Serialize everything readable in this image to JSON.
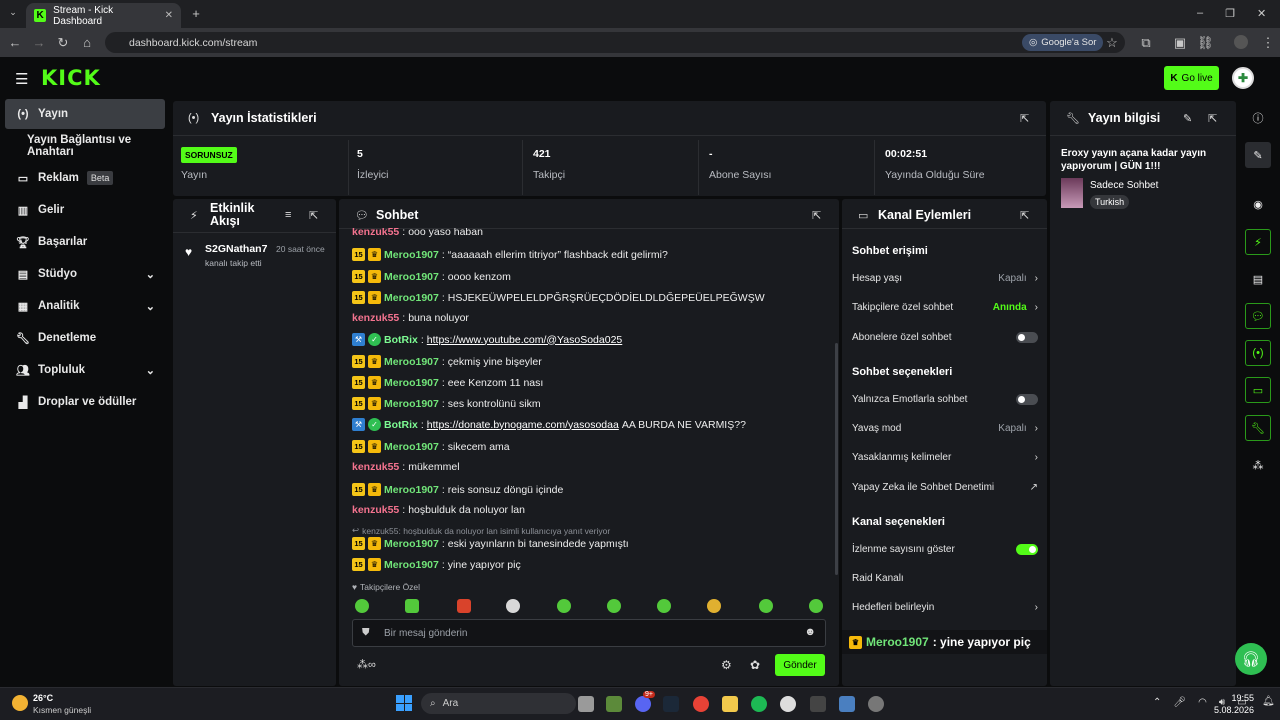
{
  "browser": {
    "tab_title": "Stream - Kick Dashboard",
    "url": "dashboard.kick.com/stream",
    "google_btn": "Google'a Sor"
  },
  "header": {
    "logo": "KICK",
    "go_live": "Go live"
  },
  "sidebar": {
    "items": [
      {
        "label": "Yayın",
        "icon": "broadcast-icon"
      },
      {
        "label": "Yayın Bağlantısı ve Anahtarı"
      },
      {
        "label": "Reklam",
        "badge": "Beta",
        "icon": "ad-icon"
      },
      {
        "label": "Gelir",
        "icon": "chart-icon"
      },
      {
        "label": "Başarılar",
        "icon": "trophy-icon"
      },
      {
        "label": "Stüdyo",
        "icon": "studio-icon"
      },
      {
        "label": "Analitik",
        "icon": "analytics-icon"
      },
      {
        "label": "Denetleme",
        "icon": "wrench-icon"
      },
      {
        "label": "Topluluk",
        "icon": "community-icon"
      },
      {
        "label": "Droplar ve ödüller",
        "icon": "drops-icon"
      }
    ]
  },
  "stats": {
    "title": "Yayın İstatistikleri",
    "badge": "SORUNSUZ",
    "items": [
      {
        "value": "",
        "label": "Yayın"
      },
      {
        "value": "5",
        "label": "İzleyici"
      },
      {
        "value": "421",
        "label": "Takipçi"
      },
      {
        "value": "-",
        "label": "Abone Sayısı"
      },
      {
        "value": "00:02:51",
        "label": "Yayında Olduğu Süre"
      }
    ]
  },
  "activity": {
    "title_l1": "Etkinlik",
    "title_l2": "Akışı",
    "user": "S2GNathan7",
    "time": "20 saat önce",
    "text": "kanalı takip etti"
  },
  "chat": {
    "title": "Sohbet",
    "top_partial": {
      "user": "kenzuk55",
      "text": "ooo yaso haban"
    },
    "messages": [
      {
        "user": "Meroo1907",
        "text": "“aaaaaah ellerim titriyor” flashback edit gelirmi?"
      },
      {
        "user": "Meroo1907",
        "text": "oooo kenzom"
      },
      {
        "user": "Meroo1907",
        "text": "HSJEKEÜWPELELDPĞRŞRÜEÇDÖDİELDLDĞEPEÜELPEĞWŞW"
      },
      {
        "user": "kenzuk55",
        "text": "buna noluyor"
      },
      {
        "user": "BotRix",
        "link": "https://www.youtube.com/@YasoSoda025",
        "text": ""
      },
      {
        "user": "Meroo1907",
        "text": "çekmiş yine bişeyler"
      },
      {
        "user": "Meroo1907",
        "text": "eee Kenzom 11 nası"
      },
      {
        "user": "Meroo1907",
        "text": "ses kontrolünü sikm"
      },
      {
        "user": "BotRix",
        "link": "https://donate.bynogame.com/yasosodaa",
        "text": " AA BURDA NE VARMIŞ??"
      },
      {
        "user": "Meroo1907",
        "text": "sikecem ama"
      },
      {
        "user": "kenzuk55",
        "text": "mükemmel"
      },
      {
        "user": "Meroo1907",
        "text": "reis sonsuz döngü içinde"
      },
      {
        "user": "kenzuk55",
        "text": "hoşbulduk da noluyor lan"
      },
      {
        "user": "Meroo1907",
        "text": "eski yayınların bi tanesindede yapmıştı"
      },
      {
        "user": "Meroo1907",
        "text": "yine yapıyor piç"
      }
    ],
    "reply_note": "kenzuk55: hoşbulduk da noluyor lan isimli kullanıcıya yanıt veriyor",
    "sub_badge": "15",
    "followers_only": "Takipçilere Özel",
    "placeholder": "Bir mesaj gönderin",
    "send": "Gönder"
  },
  "channel": {
    "title": "Kanal Eylemleri",
    "chat_access": "Sohbet erişimi",
    "account_age": "Hesap yaşı",
    "account_age_val": "Kapalı",
    "followers_chat": "Takipçilere özel sohbet",
    "followers_chat_val": "Anında",
    "subs_chat": "Abonelere özel sohbet",
    "chat_options": "Sohbet seçenekleri",
    "emote_only": "Yalnızca Emotlarla sohbet",
    "slow_mode": "Yavaş mod",
    "slow_mode_val": "Kapalı",
    "banned_words": "Yasaklanmış kelimeler",
    "ai_moderation": "Yapay Zeka ile Sohbet Denetimi",
    "channel_options": "Kanal seçenekleri",
    "show_viewers": "İzlenme sayısını göster",
    "raid": "Raid Kanalı",
    "goals": "Hedefleri belirleyin",
    "pinned_user": "Meroo1907",
    "pinned_text": " : yine yapıyor piç"
  },
  "info": {
    "title": "Yayın bilgisi",
    "stream_title": "Eroxy yayın açana kadar yayın yapıyorum | GÜN 1!!!",
    "category": "Sadece Sohbet",
    "language": "Turkish"
  },
  "taskbar": {
    "temp": "26°C",
    "weather": "Kısmen güneşli",
    "search": "Ara",
    "time": "19:55",
    "date": "5.08.2026",
    "notif": "9+"
  },
  "colors": {
    "accent": "#53fc18",
    "panel": "#191b1f",
    "meroo": "#71e579",
    "kenzuk": "#f4738f"
  }
}
